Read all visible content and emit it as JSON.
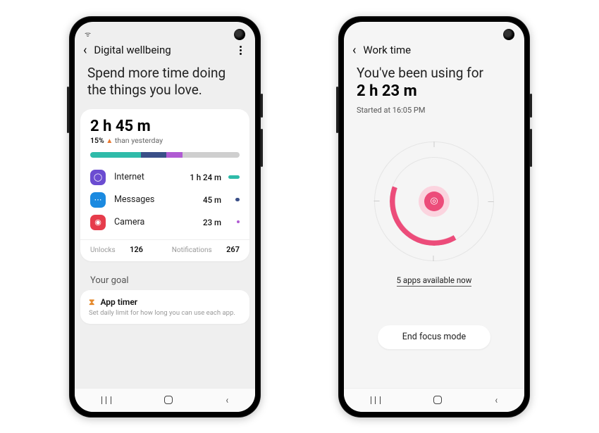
{
  "left": {
    "title": "Digital wellbeing",
    "headline": "Spend more time doing the things you love.",
    "total_time": "2 h 45 m",
    "delta_pct": "15%",
    "delta_txt": " than yesterday",
    "segments": [
      {
        "color": "#2fbba9",
        "width": 34
      },
      {
        "color": "#3a4f88",
        "width": 17
      },
      {
        "color": "#b05bd3",
        "width": 11
      },
      {
        "color": "#cfcfcf",
        "width": 38
      }
    ],
    "apps": [
      {
        "name": "Internet",
        "time": "1 h 24 m",
        "icon_bg": "#6b4cd1",
        "icon_fg": "#fff",
        "glyph": "◯"
      },
      {
        "name": "Messages",
        "time": "45 m",
        "icon_bg": "#1b8ae0",
        "icon_fg": "#fff",
        "glyph": "⋯"
      },
      {
        "name": "Camera",
        "time": "23 m",
        "icon_bg": "#e63c4b",
        "icon_fg": "#fff",
        "glyph": "◉"
      }
    ],
    "unlocks_label": "Unlocks",
    "unlocks_val": "126",
    "notif_label": "Notifications",
    "notif_val": "267",
    "goal_header": "Your goal",
    "apptimer_title": "App timer",
    "apptimer_sub": "Set daily limit for how long you can use each app."
  },
  "right": {
    "title": "Work time",
    "line1": "You've been using for",
    "line2": "2 h 23 m",
    "line3": "Started at 16:05 PM",
    "apps_link": "5 apps available now",
    "end_label": "End focus mode",
    "accent": "#ec4c7a"
  }
}
